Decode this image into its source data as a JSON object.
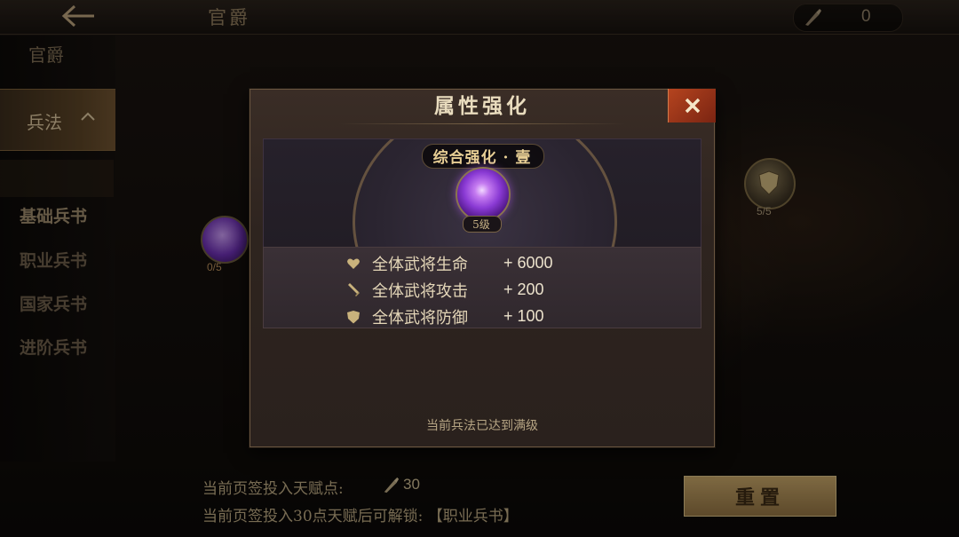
{
  "header": {
    "title": "官爵",
    "currency_value": "0",
    "currency_icon": "brush-icon"
  },
  "sidebar": {
    "sections": [
      {
        "label": "官爵"
      },
      {
        "label": "兵法",
        "expanded": true
      }
    ],
    "items": [
      {
        "label": "基础兵书",
        "selected": true
      },
      {
        "label": "职业兵书"
      },
      {
        "label": "国家兵书"
      },
      {
        "label": "进阶兵书"
      }
    ]
  },
  "background_nodes": {
    "left_progress": "0/5",
    "right_progress": "5/5"
  },
  "modal": {
    "title": "属性强化",
    "skill_name": "综合强化 · 壹",
    "skill_level": "5级",
    "stats": [
      {
        "icon": "heart-icon",
        "label": "全体武将生命",
        "value": "+ 6000"
      },
      {
        "icon": "sword-icon",
        "label": "全体武将攻击",
        "value": "+ 200"
      },
      {
        "icon": "shield-icon",
        "label": "全体武将防御",
        "value": "+ 100"
      }
    ],
    "note": "当前兵法已达到满级"
  },
  "footer": {
    "invested_label": "当前页签投入天赋点:",
    "invested_value": "30",
    "unlock_text": "当前页签投入30点天赋后可解锁: 【职业兵书】",
    "reset_label": "重置"
  },
  "colors": {
    "accent_gold": "#c2a266",
    "close_red": "#b5441f",
    "skill_purple": "#8a3ad4"
  }
}
